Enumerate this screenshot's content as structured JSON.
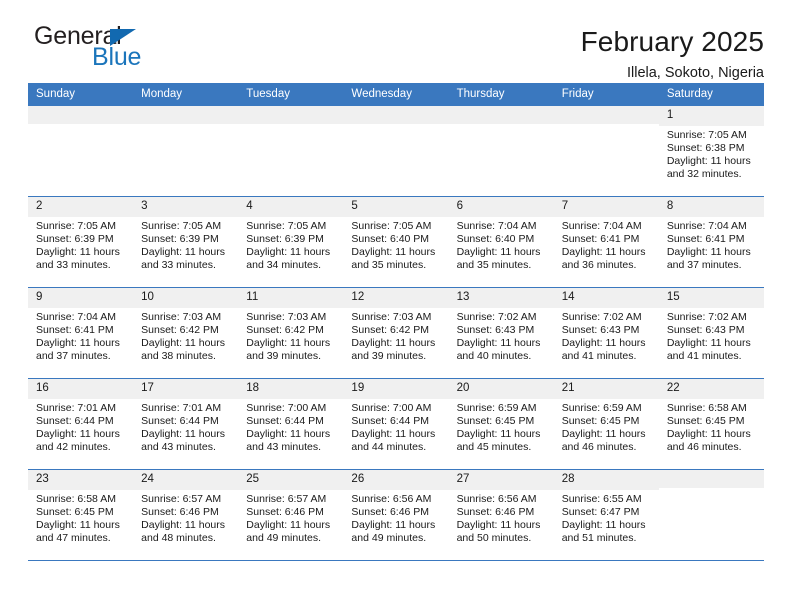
{
  "brand": {
    "name_primary": "General",
    "name_secondary": "Blue",
    "triangle_icon": "triangle-icon",
    "accent_color": "#1b75bb"
  },
  "header": {
    "title": "February 2025",
    "subtitle": "Illela, Sokoto, Nigeria"
  },
  "theme": {
    "header_row_bg": "#3a78bf",
    "daynum_bg": "#f0f0f0",
    "grid_line": "#3a78bf",
    "text": "#1a1a1a"
  },
  "weekdays": [
    "Sunday",
    "Monday",
    "Tuesday",
    "Wednesday",
    "Thursday",
    "Friday",
    "Saturday"
  ],
  "labels": {
    "sunrise": "Sunrise:",
    "sunset": "Sunset:",
    "daylight": "Daylight:"
  },
  "weeks": [
    [
      {
        "day": "",
        "blank": true
      },
      {
        "day": "",
        "blank": true
      },
      {
        "day": "",
        "blank": true
      },
      {
        "day": "",
        "blank": true
      },
      {
        "day": "",
        "blank": true
      },
      {
        "day": "",
        "blank": true
      },
      {
        "day": "1",
        "sunrise": "Sunrise: 7:05 AM",
        "sunset": "Sunset: 6:38 PM",
        "daylight_1": "Daylight: 11 hours",
        "daylight_2": "and 32 minutes."
      }
    ],
    [
      {
        "day": "2",
        "sunrise": "Sunrise: 7:05 AM",
        "sunset": "Sunset: 6:39 PM",
        "daylight_1": "Daylight: 11 hours",
        "daylight_2": "and 33 minutes."
      },
      {
        "day": "3",
        "sunrise": "Sunrise: 7:05 AM",
        "sunset": "Sunset: 6:39 PM",
        "daylight_1": "Daylight: 11 hours",
        "daylight_2": "and 33 minutes."
      },
      {
        "day": "4",
        "sunrise": "Sunrise: 7:05 AM",
        "sunset": "Sunset: 6:39 PM",
        "daylight_1": "Daylight: 11 hours",
        "daylight_2": "and 34 minutes."
      },
      {
        "day": "5",
        "sunrise": "Sunrise: 7:05 AM",
        "sunset": "Sunset: 6:40 PM",
        "daylight_1": "Daylight: 11 hours",
        "daylight_2": "and 35 minutes."
      },
      {
        "day": "6",
        "sunrise": "Sunrise: 7:04 AM",
        "sunset": "Sunset: 6:40 PM",
        "daylight_1": "Daylight: 11 hours",
        "daylight_2": "and 35 minutes."
      },
      {
        "day": "7",
        "sunrise": "Sunrise: 7:04 AM",
        "sunset": "Sunset: 6:41 PM",
        "daylight_1": "Daylight: 11 hours",
        "daylight_2": "and 36 minutes."
      },
      {
        "day": "8",
        "sunrise": "Sunrise: 7:04 AM",
        "sunset": "Sunset: 6:41 PM",
        "daylight_1": "Daylight: 11 hours",
        "daylight_2": "and 37 minutes."
      }
    ],
    [
      {
        "day": "9",
        "sunrise": "Sunrise: 7:04 AM",
        "sunset": "Sunset: 6:41 PM",
        "daylight_1": "Daylight: 11 hours",
        "daylight_2": "and 37 minutes."
      },
      {
        "day": "10",
        "sunrise": "Sunrise: 7:03 AM",
        "sunset": "Sunset: 6:42 PM",
        "daylight_1": "Daylight: 11 hours",
        "daylight_2": "and 38 minutes."
      },
      {
        "day": "11",
        "sunrise": "Sunrise: 7:03 AM",
        "sunset": "Sunset: 6:42 PM",
        "daylight_1": "Daylight: 11 hours",
        "daylight_2": "and 39 minutes."
      },
      {
        "day": "12",
        "sunrise": "Sunrise: 7:03 AM",
        "sunset": "Sunset: 6:42 PM",
        "daylight_1": "Daylight: 11 hours",
        "daylight_2": "and 39 minutes."
      },
      {
        "day": "13",
        "sunrise": "Sunrise: 7:02 AM",
        "sunset": "Sunset: 6:43 PM",
        "daylight_1": "Daylight: 11 hours",
        "daylight_2": "and 40 minutes."
      },
      {
        "day": "14",
        "sunrise": "Sunrise: 7:02 AM",
        "sunset": "Sunset: 6:43 PM",
        "daylight_1": "Daylight: 11 hours",
        "daylight_2": "and 41 minutes."
      },
      {
        "day": "15",
        "sunrise": "Sunrise: 7:02 AM",
        "sunset": "Sunset: 6:43 PM",
        "daylight_1": "Daylight: 11 hours",
        "daylight_2": "and 41 minutes."
      }
    ],
    [
      {
        "day": "16",
        "sunrise": "Sunrise: 7:01 AM",
        "sunset": "Sunset: 6:44 PM",
        "daylight_1": "Daylight: 11 hours",
        "daylight_2": "and 42 minutes."
      },
      {
        "day": "17",
        "sunrise": "Sunrise: 7:01 AM",
        "sunset": "Sunset: 6:44 PM",
        "daylight_1": "Daylight: 11 hours",
        "daylight_2": "and 43 minutes."
      },
      {
        "day": "18",
        "sunrise": "Sunrise: 7:00 AM",
        "sunset": "Sunset: 6:44 PM",
        "daylight_1": "Daylight: 11 hours",
        "daylight_2": "and 43 minutes."
      },
      {
        "day": "19",
        "sunrise": "Sunrise: 7:00 AM",
        "sunset": "Sunset: 6:44 PM",
        "daylight_1": "Daylight: 11 hours",
        "daylight_2": "and 44 minutes."
      },
      {
        "day": "20",
        "sunrise": "Sunrise: 6:59 AM",
        "sunset": "Sunset: 6:45 PM",
        "daylight_1": "Daylight: 11 hours",
        "daylight_2": "and 45 minutes."
      },
      {
        "day": "21",
        "sunrise": "Sunrise: 6:59 AM",
        "sunset": "Sunset: 6:45 PM",
        "daylight_1": "Daylight: 11 hours",
        "daylight_2": "and 46 minutes."
      },
      {
        "day": "22",
        "sunrise": "Sunrise: 6:58 AM",
        "sunset": "Sunset: 6:45 PM",
        "daylight_1": "Daylight: 11 hours",
        "daylight_2": "and 46 minutes."
      }
    ],
    [
      {
        "day": "23",
        "sunrise": "Sunrise: 6:58 AM",
        "sunset": "Sunset: 6:45 PM",
        "daylight_1": "Daylight: 11 hours",
        "daylight_2": "and 47 minutes."
      },
      {
        "day": "24",
        "sunrise": "Sunrise: 6:57 AM",
        "sunset": "Sunset: 6:46 PM",
        "daylight_1": "Daylight: 11 hours",
        "daylight_2": "and 48 minutes."
      },
      {
        "day": "25",
        "sunrise": "Sunrise: 6:57 AM",
        "sunset": "Sunset: 6:46 PM",
        "daylight_1": "Daylight: 11 hours",
        "daylight_2": "and 49 minutes."
      },
      {
        "day": "26",
        "sunrise": "Sunrise: 6:56 AM",
        "sunset": "Sunset: 6:46 PM",
        "daylight_1": "Daylight: 11 hours",
        "daylight_2": "and 49 minutes."
      },
      {
        "day": "27",
        "sunrise": "Sunrise: 6:56 AM",
        "sunset": "Sunset: 6:46 PM",
        "daylight_1": "Daylight: 11 hours",
        "daylight_2": "and 50 minutes."
      },
      {
        "day": "28",
        "sunrise": "Sunrise: 6:55 AM",
        "sunset": "Sunset: 6:47 PM",
        "daylight_1": "Daylight: 11 hours",
        "daylight_2": "and 51 minutes."
      },
      {
        "day": "",
        "blank": true
      }
    ]
  ]
}
